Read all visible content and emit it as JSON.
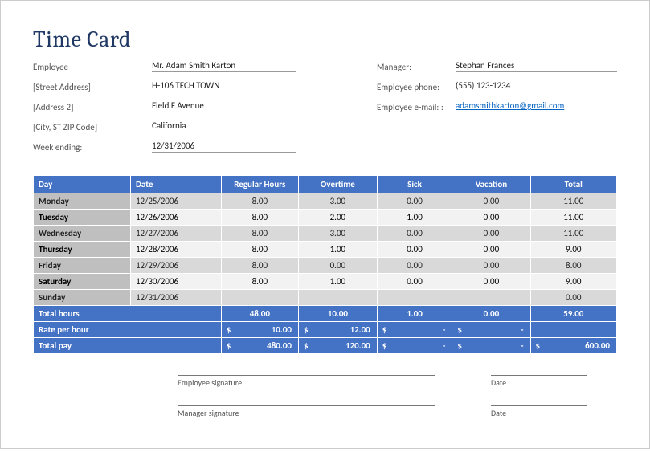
{
  "title": "Time Card",
  "left_info": [
    {
      "label": "Employee",
      "value": "Mr. Adam Smith Karton"
    },
    {
      "label": "[Street Address]",
      "value": "H-106 TECH TOWN"
    },
    {
      "label": "[Address 2]",
      "value": "Field F Avenue"
    },
    {
      "label": "[City, ST  ZIP Code]",
      "value": "California"
    },
    {
      "label": "Week ending:",
      "value": "12/31/2006"
    }
  ],
  "right_info": [
    {
      "label": "Manager:",
      "value": "Stephan Frances",
      "link": false
    },
    {
      "label": "Employee phone:",
      "value": "(555) 123-1234",
      "link": false
    },
    {
      "label": "Employee e-mail: :",
      "value": "adamsmithkarton@gmail.com",
      "link": true
    }
  ],
  "headers": [
    "Day",
    "Date",
    "Regular Hours",
    "Overtime",
    "Sick",
    "Vacation",
    "Total"
  ],
  "rows": [
    {
      "day": "Monday",
      "date": "12/25/2006",
      "reg": "8.00",
      "ot": "3.00",
      "sick": "0.00",
      "vac": "0.00",
      "total": "11.00",
      "stripe": "a"
    },
    {
      "day": "Tuesday",
      "date": "12/26/2006",
      "reg": "8.00",
      "ot": "2.00",
      "sick": "1.00",
      "vac": "0.00",
      "total": "11.00",
      "stripe": "b"
    },
    {
      "day": "Wednesday",
      "date": "12/27/2006",
      "reg": "8.00",
      "ot": "3.00",
      "sick": "0.00",
      "vac": "0.00",
      "total": "11.00",
      "stripe": "a"
    },
    {
      "day": "Thursday",
      "date": "12/28/2006",
      "reg": "8.00",
      "ot": "1.00",
      "sick": "0.00",
      "vac": "0.00",
      "total": "9.00",
      "stripe": "b"
    },
    {
      "day": "Friday",
      "date": "12/29/2006",
      "reg": "8.00",
      "ot": "0.00",
      "sick": "0.00",
      "vac": "0.00",
      "total": "8.00",
      "stripe": "a"
    },
    {
      "day": "Saturday",
      "date": "12/30/2006",
      "reg": "8.00",
      "ot": "1.00",
      "sick": "0.00",
      "vac": "0.00",
      "total": "9.00",
      "stripe": "b"
    },
    {
      "day": "Sunday",
      "date": "12/31/2006",
      "reg": "",
      "ot": "",
      "sick": "",
      "vac": "",
      "total": "0.00",
      "stripe": "a"
    }
  ],
  "summary": {
    "total_hours_label": "Total hours",
    "total_hours": {
      "reg": "48.00",
      "ot": "10.00",
      "sick": "1.00",
      "vac": "0.00",
      "total": "59.00"
    },
    "rate_label": "Rate per hour",
    "rate": {
      "reg": "10.00",
      "ot": "12.00",
      "sick": "-",
      "vac": "-",
      "total": ""
    },
    "total_pay_label": "Total pay",
    "total_pay": {
      "reg": "480.00",
      "ot": "120.00",
      "sick": "-",
      "vac": "-",
      "total": "600.00"
    }
  },
  "sig": {
    "emp": "Employee signature",
    "mgr": "Manager signature",
    "date": "Date"
  }
}
